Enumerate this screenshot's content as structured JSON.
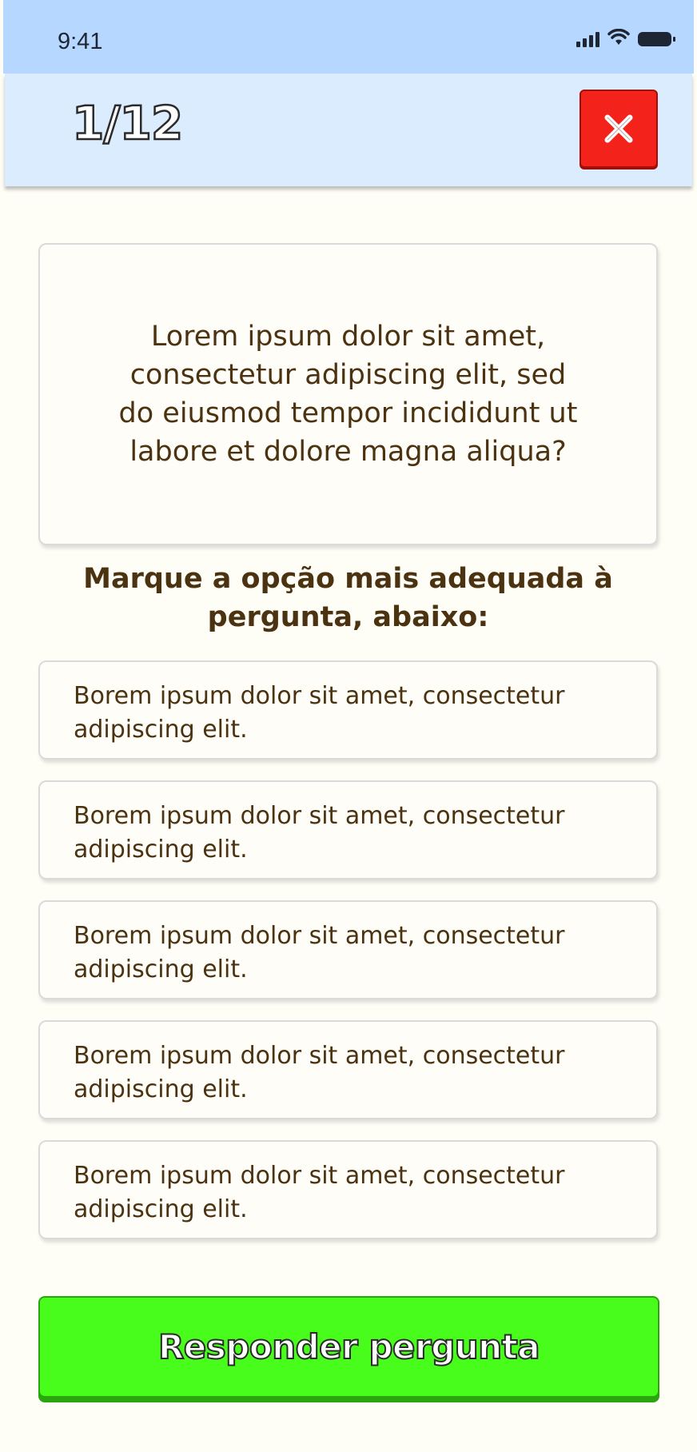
{
  "status_bar": {
    "time": "9:41",
    "icons": [
      "signal-icon",
      "wifi-icon",
      "battery-icon"
    ]
  },
  "header": {
    "progress": "1/12",
    "close_icon": "close-icon"
  },
  "question": {
    "text": "Lorem ipsum dolor sit amet, consectetur adipiscing elit, sed do eiusmod tempor incididunt ut labore et dolore magna aliqua?"
  },
  "instruction": "Marque a opção mais adequada à pergunta, abaixo:",
  "options": [
    {
      "label": "Borem ipsum dolor sit amet, consectetur adipiscing elit."
    },
    {
      "label": "Borem ipsum dolor sit amet, consectetur adipiscing elit."
    },
    {
      "label": "Borem ipsum dolor sit amet, consectetur adipiscing elit."
    },
    {
      "label": "Borem ipsum dolor sit amet, consectetur adipiscing elit."
    },
    {
      "label": "Borem ipsum dolor sit amet, consectetur adipiscing elit."
    }
  ],
  "submit": {
    "label": "Responder pergunta"
  },
  "colors": {
    "status_bar_bg": "#b6d7ff",
    "header_bg": "#dcecff",
    "page_bg": "#fefdf6",
    "close_button": "#f3231c",
    "submit_button": "#48fd1c",
    "text_brown": "#4b3210"
  }
}
